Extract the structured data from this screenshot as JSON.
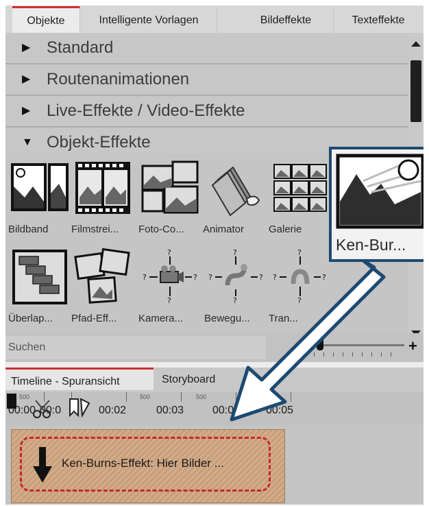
{
  "tabs": [
    "Objekte",
    "Intelligente Vorlagen",
    "Bildeffekte",
    "Texteffekte"
  ],
  "sections": [
    {
      "label": "Standard",
      "arrow": "▶"
    },
    {
      "label": "Routenanimationen",
      "arrow": "▶"
    },
    {
      "label": "Live-Effekte / Video-Effekte",
      "arrow": "▶"
    },
    {
      "label": "Objekt-Effekte",
      "arrow": "▼"
    }
  ],
  "effects_row1": [
    "Bildband",
    "Filmstrei...",
    "Foto-Co...",
    "Animator",
    "Galerie"
  ],
  "effects_row2": [
    "Überlap...",
    "Pfad-Eff...",
    "Kamera...",
    "Bewegu...",
    "Tran..."
  ],
  "popup_label": "Ken-Bur...",
  "search_placeholder": "Suchen",
  "slider_plus": "+",
  "timeline": {
    "tabs": [
      "Timeline - Spuransicht",
      "Storyboard"
    ],
    "times": [
      "00:00",
      "00:0",
      "00:02",
      "00:03",
      "00:0",
      "00:05"
    ],
    "small_500": [
      "500",
      "500",
      "500"
    ],
    "clip_text": "Ken-Burns-Effekt: Hier Bilder ..."
  },
  "colors": {
    "accent": "#cf2f2f",
    "popup_border": "#1c4a72",
    "arrow_fill": "#ffffff",
    "arrow_stroke": "#1c4a72"
  }
}
